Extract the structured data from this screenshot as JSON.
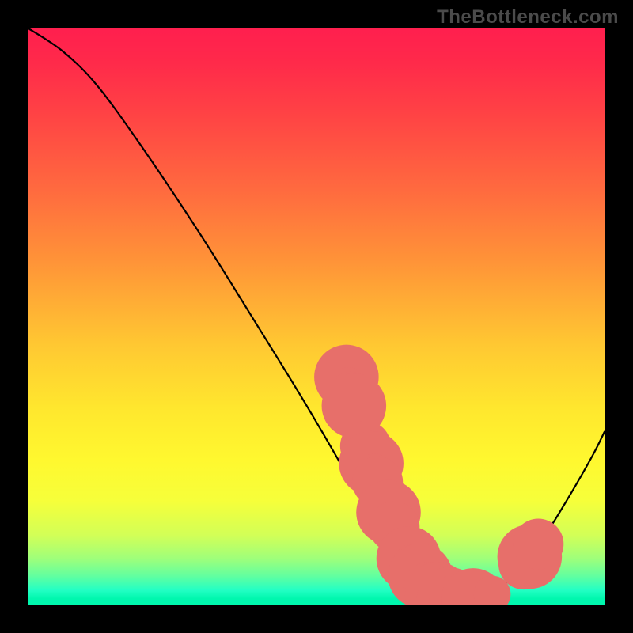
{
  "watermark": "TheBottleneck.com",
  "chart_data": {
    "type": "line",
    "xlabel": "",
    "ylabel": "",
    "xlim": [
      0,
      100
    ],
    "ylim": [
      0,
      100
    ],
    "grid": false,
    "title": "",
    "legend": null,
    "curve": [
      {
        "x": 0,
        "y": 100
      },
      {
        "x": 6,
        "y": 96
      },
      {
        "x": 12,
        "y": 90
      },
      {
        "x": 20,
        "y": 79
      },
      {
        "x": 30,
        "y": 64
      },
      {
        "x": 40,
        "y": 48
      },
      {
        "x": 48,
        "y": 35
      },
      {
        "x": 55,
        "y": 23
      },
      {
        "x": 60,
        "y": 14
      },
      {
        "x": 64,
        "y": 8
      },
      {
        "x": 68,
        "y": 3.5
      },
      {
        "x": 72,
        "y": 1.2
      },
      {
        "x": 75,
        "y": 0.5
      },
      {
        "x": 78,
        "y": 0.8
      },
      {
        "x": 82,
        "y": 3
      },
      {
        "x": 86,
        "y": 7
      },
      {
        "x": 90,
        "y": 12.5
      },
      {
        "x": 94,
        "y": 19
      },
      {
        "x": 98,
        "y": 26
      },
      {
        "x": 100,
        "y": 30
      }
    ],
    "points": [
      {
        "x": 55.2,
        "y": 39.5
      },
      {
        "x": 55.6,
        "y": 38.0
      },
      {
        "x": 56.0,
        "y": 36.0
      },
      {
        "x": 56.5,
        "y": 34.5
      },
      {
        "x": 58.5,
        "y": 27.5
      },
      {
        "x": 58.9,
        "y": 26.2
      },
      {
        "x": 59.5,
        "y": 24.5
      },
      {
        "x": 60.0,
        "y": 23.0
      },
      {
        "x": 60.6,
        "y": 21.3
      },
      {
        "x": 62.5,
        "y": 16.0
      },
      {
        "x": 63.5,
        "y": 13.5
      },
      {
        "x": 65.5,
        "y": 9.0
      },
      {
        "x": 66.0,
        "y": 8.0
      },
      {
        "x": 66.5,
        "y": 7.2
      },
      {
        "x": 67.5,
        "y": 5.8
      },
      {
        "x": 68.0,
        "y": 5.0
      },
      {
        "x": 69.5,
        "y": 3.0
      },
      {
        "x": 70.0,
        "y": 2.5
      },
      {
        "x": 71.0,
        "y": 1.8
      },
      {
        "x": 72.0,
        "y": 1.3
      },
      {
        "x": 72.5,
        "y": 1.1
      },
      {
        "x": 73.0,
        "y": 0.9
      },
      {
        "x": 74.0,
        "y": 0.7
      },
      {
        "x": 76.5,
        "y": 0.6
      },
      {
        "x": 77.2,
        "y": 0.7
      },
      {
        "x": 80.5,
        "y": 1.8
      },
      {
        "x": 86.0,
        "y": 7.0
      },
      {
        "x": 87.0,
        "y": 8.3
      },
      {
        "x": 88.5,
        "y": 10.5
      }
    ],
    "point_radius_min": 4,
    "point_radius_max": 7
  }
}
